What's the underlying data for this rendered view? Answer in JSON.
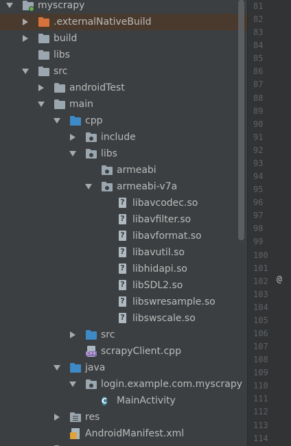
{
  "tree": {
    "items": [
      {
        "label": "myscrapy",
        "level": 0,
        "arrow": "down",
        "icon": "module-folder"
      },
      {
        "label": ".externalNativeBuild",
        "level": 1,
        "arrow": "right",
        "icon": "folder-orange",
        "selected": true
      },
      {
        "label": "build",
        "level": 1,
        "arrow": "right",
        "icon": "folder"
      },
      {
        "label": "libs",
        "level": 1,
        "arrow": "none",
        "icon": "folder"
      },
      {
        "label": "src",
        "level": 1,
        "arrow": "down",
        "icon": "folder"
      },
      {
        "label": "androidTest",
        "level": 2,
        "arrow": "right",
        "icon": "folder"
      },
      {
        "label": "main",
        "level": 2,
        "arrow": "down",
        "icon": "folder"
      },
      {
        "label": "cpp",
        "level": 3,
        "arrow": "down",
        "icon": "folder-blue"
      },
      {
        "label": "include",
        "level": 4,
        "arrow": "right",
        "icon": "package-folder"
      },
      {
        "label": "libs",
        "level": 4,
        "arrow": "down",
        "icon": "package-folder"
      },
      {
        "label": "armeabi",
        "level": 5,
        "arrow": "none",
        "icon": "package-folder"
      },
      {
        "label": "armeabi-v7a",
        "level": 5,
        "arrow": "down",
        "icon": "package-folder"
      },
      {
        "label": "libavcodec.so",
        "level": 6,
        "arrow": "none",
        "icon": "unknown-file"
      },
      {
        "label": "libavfilter.so",
        "level": 6,
        "arrow": "none",
        "icon": "unknown-file"
      },
      {
        "label": "libavformat.so",
        "level": 6,
        "arrow": "none",
        "icon": "unknown-file"
      },
      {
        "label": "libavutil.so",
        "level": 6,
        "arrow": "none",
        "icon": "unknown-file"
      },
      {
        "label": "libhidapi.so",
        "level": 6,
        "arrow": "none",
        "icon": "unknown-file"
      },
      {
        "label": "libSDL2.so",
        "level": 6,
        "arrow": "none",
        "icon": "unknown-file"
      },
      {
        "label": "libswresample.so",
        "level": 6,
        "arrow": "none",
        "icon": "unknown-file"
      },
      {
        "label": "libswscale.so",
        "level": 6,
        "arrow": "none",
        "icon": "unknown-file"
      },
      {
        "label": "src",
        "level": 4,
        "arrow": "right",
        "icon": "folder-blue"
      },
      {
        "label": "scrapyClient.cpp",
        "level": 4,
        "arrow": "none",
        "icon": "cpp-file"
      },
      {
        "label": "java",
        "level": 3,
        "arrow": "down",
        "icon": "folder-blue"
      },
      {
        "label": "login.example.com.myscrapy",
        "level": 4,
        "arrow": "down",
        "icon": "package-folder"
      },
      {
        "label": "MainActivity",
        "level": 5,
        "arrow": "none",
        "icon": "class-c"
      },
      {
        "label": "res",
        "level": 3,
        "arrow": "right",
        "icon": "res-folder"
      },
      {
        "label": "AndroidManifest.xml",
        "level": 3,
        "arrow": "none",
        "icon": "xml-file"
      },
      {
        "label": "",
        "level": 2,
        "arrow": "right",
        "icon": "folder"
      }
    ]
  },
  "gutter": {
    "lines": [
      "81",
      "82",
      "83",
      "84",
      "85",
      "86",
      "87",
      "88",
      "89",
      "90",
      "91",
      "92",
      "93",
      "94",
      "95",
      "96",
      "97",
      "98",
      "99",
      "100",
      "101",
      "102",
      "103",
      "104",
      "105",
      "106",
      "107",
      "108",
      "109",
      "110",
      "111",
      "112",
      "113",
      "114"
    ],
    "marker_line": "102",
    "marker_text": "@"
  },
  "icon_glyphs": {
    "class": "C"
  },
  "colors": {
    "background": "#3c3f41",
    "selection": "#4a3a2d",
    "gutter": "#313335",
    "folder_orange": "#d6733c",
    "folder_blue": "#3d8ac6",
    "folder_gray": "#9aa7b0"
  }
}
